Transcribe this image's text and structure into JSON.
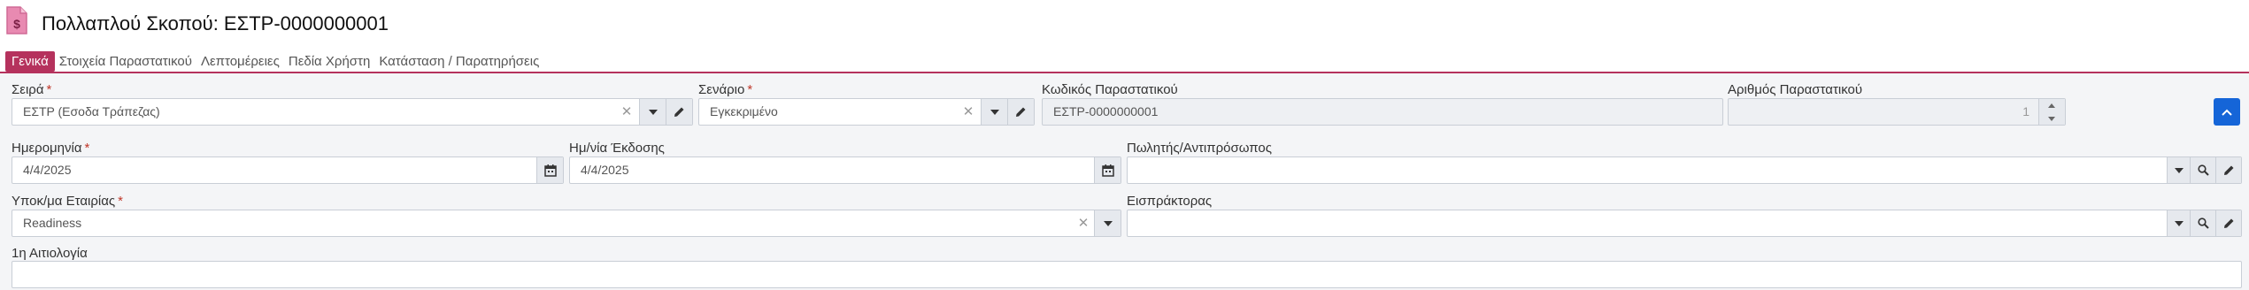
{
  "header": {
    "title": "Πολλαπλού Σκοπού: ΕΣΤΡ-0000000001",
    "icon": "document-dollar-icon",
    "icon_color": "#e88ab1"
  },
  "tabs": [
    {
      "label": "Γενικά",
      "active": true
    },
    {
      "label": "Στοιχεία Παραστατικού",
      "active": false
    },
    {
      "label": "Λεπτομέρειες",
      "active": false
    },
    {
      "label": "Πεδία Χρήστη",
      "active": false
    },
    {
      "label": "Κατάσταση / Παρατηρήσεις",
      "active": false
    }
  ],
  "form": {
    "series": {
      "label": "Σειρά",
      "required": "*",
      "value": "ΕΣΤΡ (Εσοδα Τράπεζας)"
    },
    "scenario": {
      "label": "Σενάριο",
      "required": "*",
      "value": "Εγκεκριμένο"
    },
    "doc_code": {
      "label": "Κωδικός Παραστατικού",
      "value": "ΕΣΤΡ-0000000001"
    },
    "doc_number": {
      "label": "Αριθμός Παραστατικού",
      "value": "1"
    },
    "date": {
      "label": "Ημερομηνία",
      "required": "*",
      "value": "4/4/2025"
    },
    "issue_date": {
      "label": "Ημ/νία Έκδοσης",
      "value": "4/4/2025"
    },
    "salesman": {
      "label": "Πωλητής/Αντιπρόσωπος",
      "value": ""
    },
    "branch": {
      "label": "Υποκ/μα Εταιρίας",
      "required": "*",
      "value": "Readiness"
    },
    "collector": {
      "label": "Εισπράκτορας",
      "value": ""
    },
    "reason": {
      "label": "1η Αιτιολογία",
      "value": ""
    }
  },
  "colors": {
    "accent": "#b5325d",
    "primary_button": "#1565d8",
    "form_background": "#f4f5f7"
  }
}
